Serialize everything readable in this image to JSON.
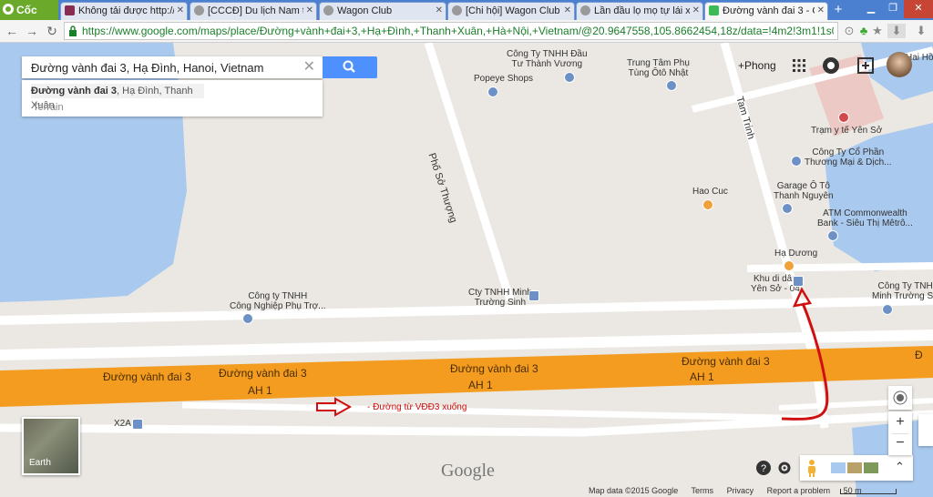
{
  "tabs": [
    {
      "label": "Không tải được http://vne",
      "color": "#8a2b52"
    },
    {
      "label": "[CCCĐ] Du lịch Nam tiến",
      "color": "#9a9a9a"
    },
    {
      "label": "Wagon Club",
      "color": "#9a9a9a"
    },
    {
      "label": "[Chi hội] Wagon Club - N",
      "color": "#9a9a9a"
    },
    {
      "label": "Lần đầu lọ mọ tự lái xe đi",
      "color": "#9a9a9a"
    },
    {
      "label": "Đường vành đai 3 - Googl",
      "color": "#3cba54"
    }
  ],
  "brand": "Cốc Cốc",
  "url": "https://www.google.com/maps/place/Đường+vành+đai+3,+Hạ+Đình,+Thanh+Xuân,+Hà+Nội,+Vietnam/@20.9647558,105.8662454,18z/data=!4m2!3m1!1s0",
  "search": {
    "value": "Đường vành đai 3, Hạ Đình, Hanoi, Vietnam",
    "suggest_bold": "Đường vành đai 3",
    "suggest_rest": ", Hạ Đình, Thanh Xuân",
    "option": "Terrain"
  },
  "topright": {
    "plus": "+Phong"
  },
  "labels": {
    "cty_dau_tu": "Công Ty TNHH Đầu\nTư Thành Vương",
    "popeye": "Popeye Shops",
    "trung_tam": "Trung Tâm Phụ\nTùng Ôtô Nhật",
    "pho_so_thuong": "Phố Sở Thượng",
    "tam_trinh": "Tam Trinh",
    "tram_yte": "Trạm y tế Yên Sở",
    "cty_co_phan": "Công Ty Cổ Phần\nThương Mại & Dịch...",
    "hao_cuc": "Hao Cuc",
    "garage": "Garage Ô Tô\nThanh Nguyên",
    "atm": "ATM Commonwealth\nBank - Siêu Thị Mêtrô...",
    "ha_duong": "Hạ Dương",
    "khu_di_dan": "Khu di dân\nYên Sở - 04",
    "cty_cong_nghiep": "Công ty TNHH\nCông Nghiệp Phụ Trợ...",
    "cty_minh": "Cty TNHH Minh\nTrường Sinh",
    "cty_minh_right": "Công Ty TNHH\nMinh Trường Sinh",
    "x2a": "X2A",
    "ring1": "Đường vành đai 3",
    "ring2": "Đường vành đai 3",
    "ring3": "Đường vành đai 3",
    "ring4": "Đường vành đai 3",
    "ah1a": "AH 1",
    "ah1b": "AH 1",
    "ah1c": "AH 1",
    "annot": "- Đường từ VĐĐ3 xuống",
    "hai_hon": "Hai Hồn",
    "right_d": "Đ"
  },
  "earth": "Earth",
  "google_logo": "Google",
  "footer": {
    "data": "Map data ©2015 Google",
    "terms": "Terms",
    "privacy": "Privacy",
    "report": "Report a problem",
    "scale": "50 m"
  },
  "colors": {
    "ring_road": "#f39c20",
    "water": "#a9c9ee",
    "land": "#ebe8e3",
    "road": "#ffffff",
    "annotation": "#d01010"
  }
}
